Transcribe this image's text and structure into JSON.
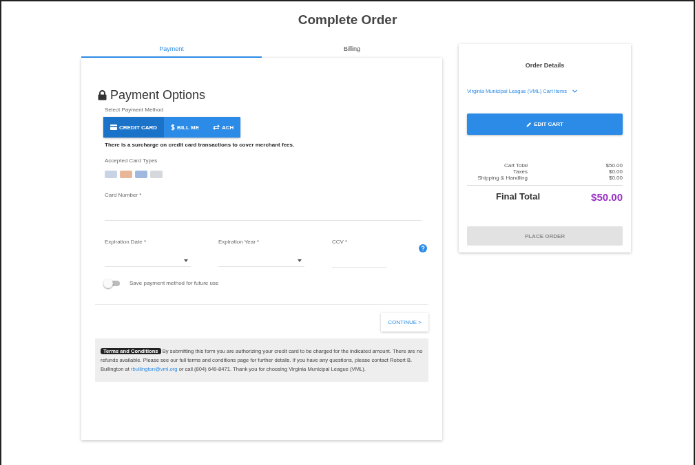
{
  "title": "Complete Order",
  "tabs": [
    {
      "label": "Payment",
      "selected": true
    },
    {
      "label": "Billing",
      "selected": false
    }
  ],
  "payment": {
    "heading": "Payment Options",
    "method_label": "Select Payment Method",
    "methods": [
      {
        "label": "CREDIT CARD",
        "kind": "card",
        "selected": true
      },
      {
        "label": "BILL ME",
        "kind": "dollar",
        "selected": false
      },
      {
        "label": "ACH",
        "kind": "exchange",
        "selected": false
      }
    ],
    "surcharge_note": "There is a surcharge on credit card transactions to cover merchant fees.",
    "card_types_label": "Accepted Card Types",
    "card_types": [
      {
        "color": "#c9d3e6"
      },
      {
        "color": "#e8b79a"
      },
      {
        "color": "#9fb8e0"
      },
      {
        "color": "#d5d8dc"
      }
    ],
    "card_number_label": "Card Number *",
    "expiration_date_label": "Expiration Date *",
    "expiration_year_label": "Expiration Year *",
    "cvv_label": "CCV *",
    "save_toggle": {
      "label": "Save payment method for future use",
      "on": false
    },
    "continue_button": "CONTINUE >",
    "terms": {
      "badge": "Terms and Conditions",
      "before_link": "By submitting this form you are authorizing your credit card to be charged for the indicated amount. There are no refunds available. Please see our full terms and conditions page for further details. If you have any questions, please contact Robert B. Bullington at",
      "link": "rbullington@vml.org",
      "after_link": "or call (804) 649-8471. Thank you for choosing Virginia Municipal League (VML)."
    }
  },
  "order": {
    "heading": "Order Details",
    "cart_dropdown": "Virginia Municipal League (VML) Cart Items",
    "edit_cart": "EDIT CART",
    "lines": [
      {
        "label": "Cart Total",
        "value": "$50.00"
      },
      {
        "label": "Taxes",
        "value": "$0.00"
      },
      {
        "label": "Shipping & Handling",
        "value": "$0.00"
      }
    ],
    "final_label": "Final Total",
    "final_value": "$50.00",
    "place_order": {
      "label": "PLACE ORDER",
      "disabled": true
    }
  }
}
